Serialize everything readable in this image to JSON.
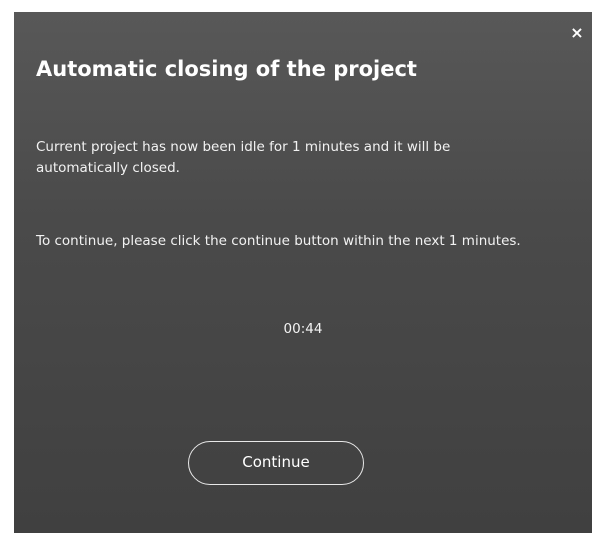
{
  "dialog": {
    "close_label": "×",
    "title": "Automatic closing of the project",
    "message_idle": "Current project has now been idle for 1 minutes and it will be automatically closed.",
    "message_continue": "To continue, please click the continue button within the next 1 minutes.",
    "countdown": "00:44",
    "continue_label": "Continue"
  },
  "colors": {
    "dialog_bg_top": "#585858",
    "dialog_bg_bottom": "#404040",
    "text": "#ffffff",
    "button_border": "#e8e8e8"
  },
  "icons": {
    "close": "close-icon"
  }
}
